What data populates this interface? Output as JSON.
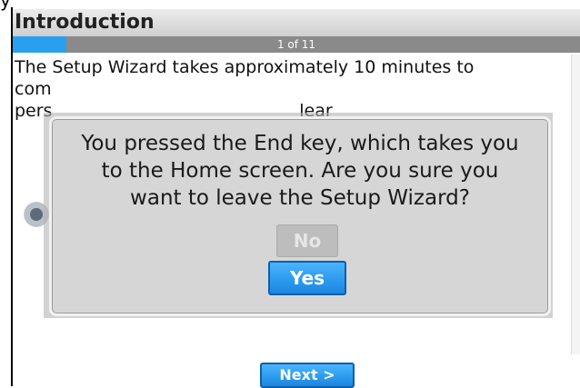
{
  "header": {
    "title": "Introduction"
  },
  "progress": {
    "text": "1 of 11",
    "fraction": 0.094
  },
  "content": {
    "intro_text": "The Setup Wizard takes approximately 10 minutes to com                                             pers                                             lear"
  },
  "dialog": {
    "message": "You pressed the End key, which takes you to the Home screen. Are you sure you want to leave the Setup Wizard?",
    "no_label": "No",
    "yes_label": "Yes"
  },
  "footer": {
    "next_label": "Next >"
  },
  "top_fragment": "y",
  "colors": {
    "accent": "#2a9ff0",
    "dialog_bg": "#d6d6d6"
  }
}
